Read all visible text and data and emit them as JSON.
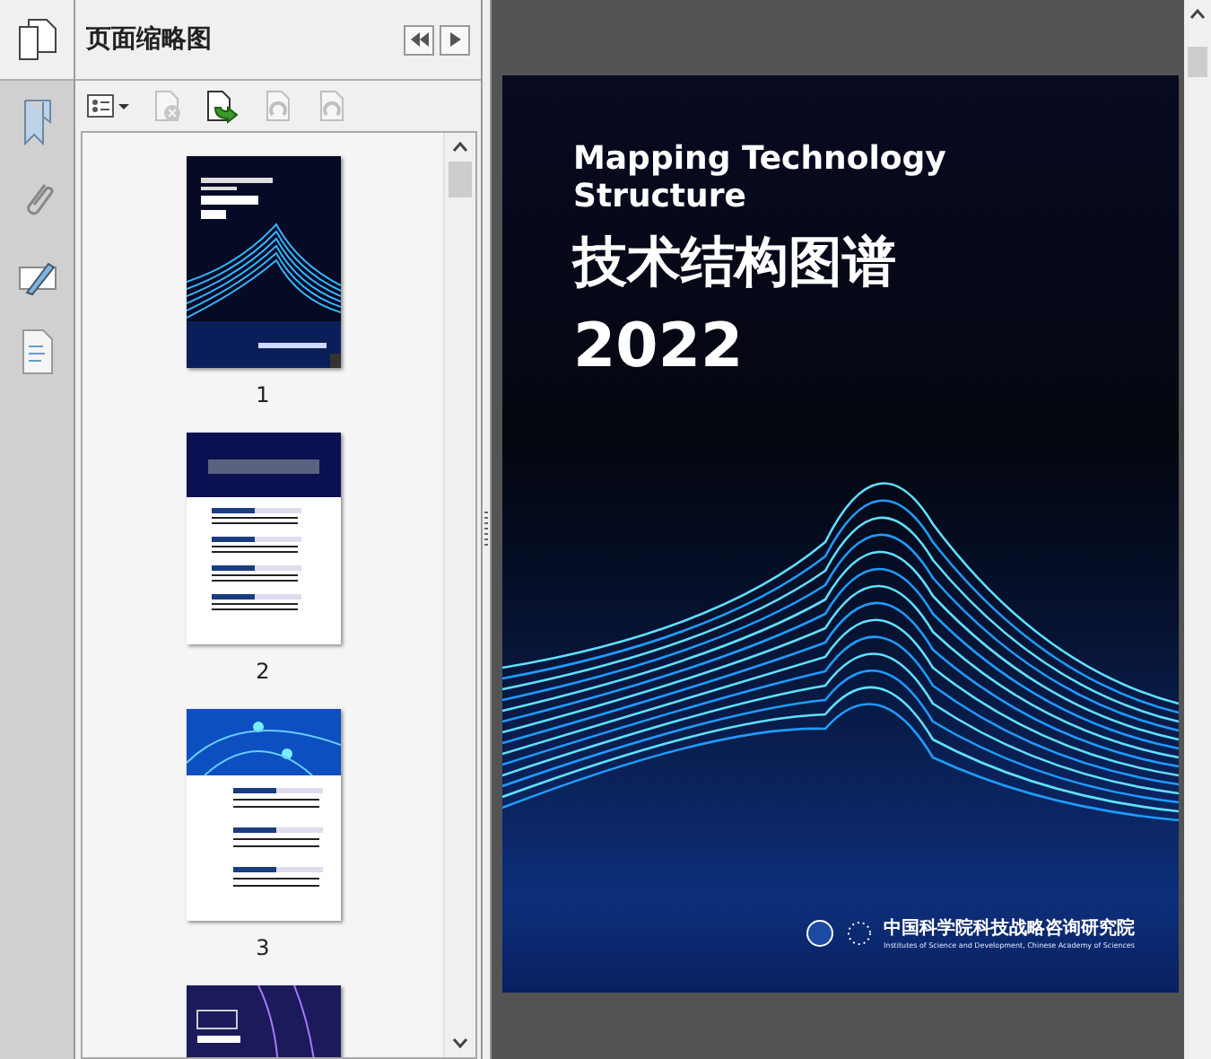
{
  "panel": {
    "title": "页面缩略图"
  },
  "tools": [
    {
      "kind": "options",
      "disabled": false
    },
    {
      "kind": "delete",
      "disabled": true
    },
    {
      "kind": "insert",
      "disabled": false
    },
    {
      "kind": "undo",
      "disabled": true
    },
    {
      "kind": "redo",
      "disabled": true
    }
  ],
  "thumbnails": [
    {
      "kind": "cover",
      "label": "1"
    },
    {
      "kind": "contents",
      "label": "2"
    },
    {
      "kind": "section",
      "label": "3"
    },
    {
      "kind": "chapter"
    }
  ],
  "cover": {
    "title_en": [
      "Mapping Technology",
      "Structure"
    ],
    "title_zh": "技术结构图谱",
    "year": "2022",
    "org_zh": "中国科学院科技战略咨询研究院",
    "org_en": "Institutes of Science and Development, Chinese Academy of Sciences"
  }
}
